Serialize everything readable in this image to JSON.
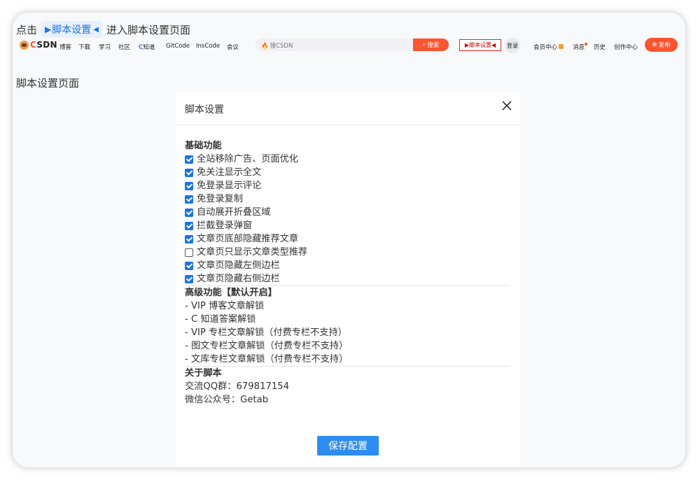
{
  "instruction": {
    "prefix": "点击",
    "chip_label": "脚本设置",
    "suffix": "进入脚本设置页面"
  },
  "csdn_bar": {
    "logo": {
      "c": "C",
      "rest": "SDN"
    },
    "nav": [
      "博客",
      "下载",
      "学习",
      "社区",
      "知道",
      "GitCode",
      "InsCode",
      "会议"
    ],
    "zhi_prefix": "C",
    "search": {
      "placeholder": "搜CSDN",
      "button": "搜索"
    },
    "script_settings_label": "脚本设置",
    "login": "登录",
    "right": [
      "会员中心",
      "消息",
      "历史",
      "创作中心"
    ],
    "publish": "发布"
  },
  "page_label": "脚本设置页面",
  "modal": {
    "title": "脚本设置",
    "basic": {
      "title": "基础功能",
      "items": [
        {
          "label": "全站移除广告、页面优化",
          "checked": true
        },
        {
          "label": "免关注显示全文",
          "checked": true
        },
        {
          "label": "免登录显示评论",
          "checked": true
        },
        {
          "label": "免登录复制",
          "checked": true
        },
        {
          "label": "自动展开折叠区域",
          "checked": true
        },
        {
          "label": "拦截登录弹窗",
          "checked": true
        },
        {
          "label": "文章页底部隐藏推荐文章",
          "checked": true
        },
        {
          "label": "文章页只显示文章类型推荐",
          "checked": false
        },
        {
          "label": "文章页隐藏左侧边栏",
          "checked": true
        },
        {
          "label": "文章页隐藏右侧边栏",
          "checked": true
        }
      ]
    },
    "advanced": {
      "title": "高级功能【默认开启】",
      "items": [
        "- VIP 博客文章解锁",
        "- C 知道答案解锁",
        "- VIP 专栏文章解锁（付费专栏不支持）",
        "- 图文专栏文章解锁（付费专栏不支持）",
        "- 文库专栏文章解锁（付费专栏不支持）"
      ]
    },
    "about": {
      "title": "关于脚本",
      "qq": "交流QQ群：679817154",
      "wechat": "微信公众号：Getab"
    },
    "save_button": "保存配置"
  },
  "colors": {
    "accent": "#2d8cf0",
    "csdn_red": "#fc5531",
    "checkbox_blue": "#1a73e8"
  }
}
